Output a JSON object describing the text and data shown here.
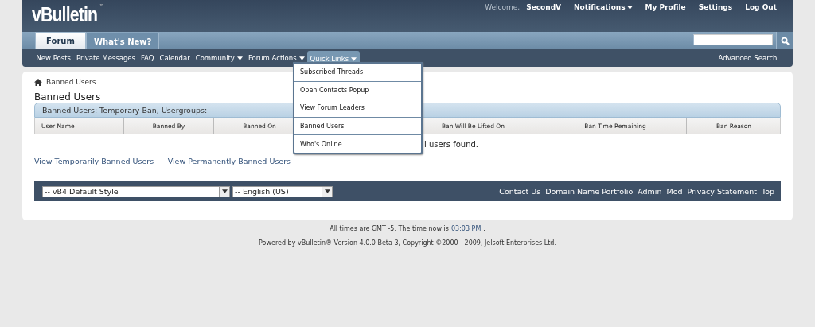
{
  "header": {
    "logo": "vBulletin",
    "logo_mark": "™",
    "welcome": "Welcome,",
    "username": "SecondV",
    "links": [
      {
        "label": "Notifications",
        "dropdown": true
      },
      {
        "label": "My Profile",
        "dropdown": false
      },
      {
        "label": "Settings",
        "dropdown": false
      },
      {
        "label": "Log Out",
        "dropdown": false
      }
    ]
  },
  "tabs": [
    {
      "label": "Forum",
      "selected": true
    },
    {
      "label": "What's New?",
      "selected": false
    }
  ],
  "subnav": [
    {
      "label": "New Posts",
      "dropdown": false,
      "selected": false
    },
    {
      "label": "Private Messages",
      "dropdown": false,
      "selected": false
    },
    {
      "label": "FAQ",
      "dropdown": false,
      "selected": false
    },
    {
      "label": "Calendar",
      "dropdown": false,
      "selected": false
    },
    {
      "label": "Community",
      "dropdown": true,
      "selected": false
    },
    {
      "label": "Forum Actions",
      "dropdown": true,
      "selected": false
    },
    {
      "label": "Quick Links",
      "dropdown": true,
      "selected": true
    }
  ],
  "advanced_search": "Advanced Search",
  "quick_links_menu": [
    "Subscribed Threads",
    "Open Contacts Popup",
    "View Forum Leaders",
    "Banned Users",
    "Who's Online"
  ],
  "breadcrumb": "Banned Users",
  "page_title": "Banned Users",
  "table": {
    "caption": "Banned Users: Temporary Ban, Usergroups:",
    "columns": [
      "User Name",
      "Banned By",
      "Banned On",
      "Ban Will Be Lifted On",
      "Ban Time Remaining",
      "Ban Reason"
    ],
    "empty_message": "l users found."
  },
  "view_links": [
    {
      "label": "View Temporarily Banned Users"
    },
    {
      "label": "View Permanently Banned Users"
    }
  ],
  "view_separator": "—",
  "footer": {
    "style_select": "-- vB4 Default Style",
    "language_select": "-- English (US)",
    "links": [
      "Contact Us",
      "Domain Name Portfolio",
      "Admin",
      "Mod",
      "Privacy Statement",
      "Top"
    ]
  },
  "time_label": "All times are GMT -5. The time now is",
  "time": "03:03 PM",
  "time_end": ".",
  "powered_by": "Powered by vBulletin® Version 4.0.0 Beta 3, Copyright ©2000 - 2009, Jelsoft Enterprises Ltd."
}
